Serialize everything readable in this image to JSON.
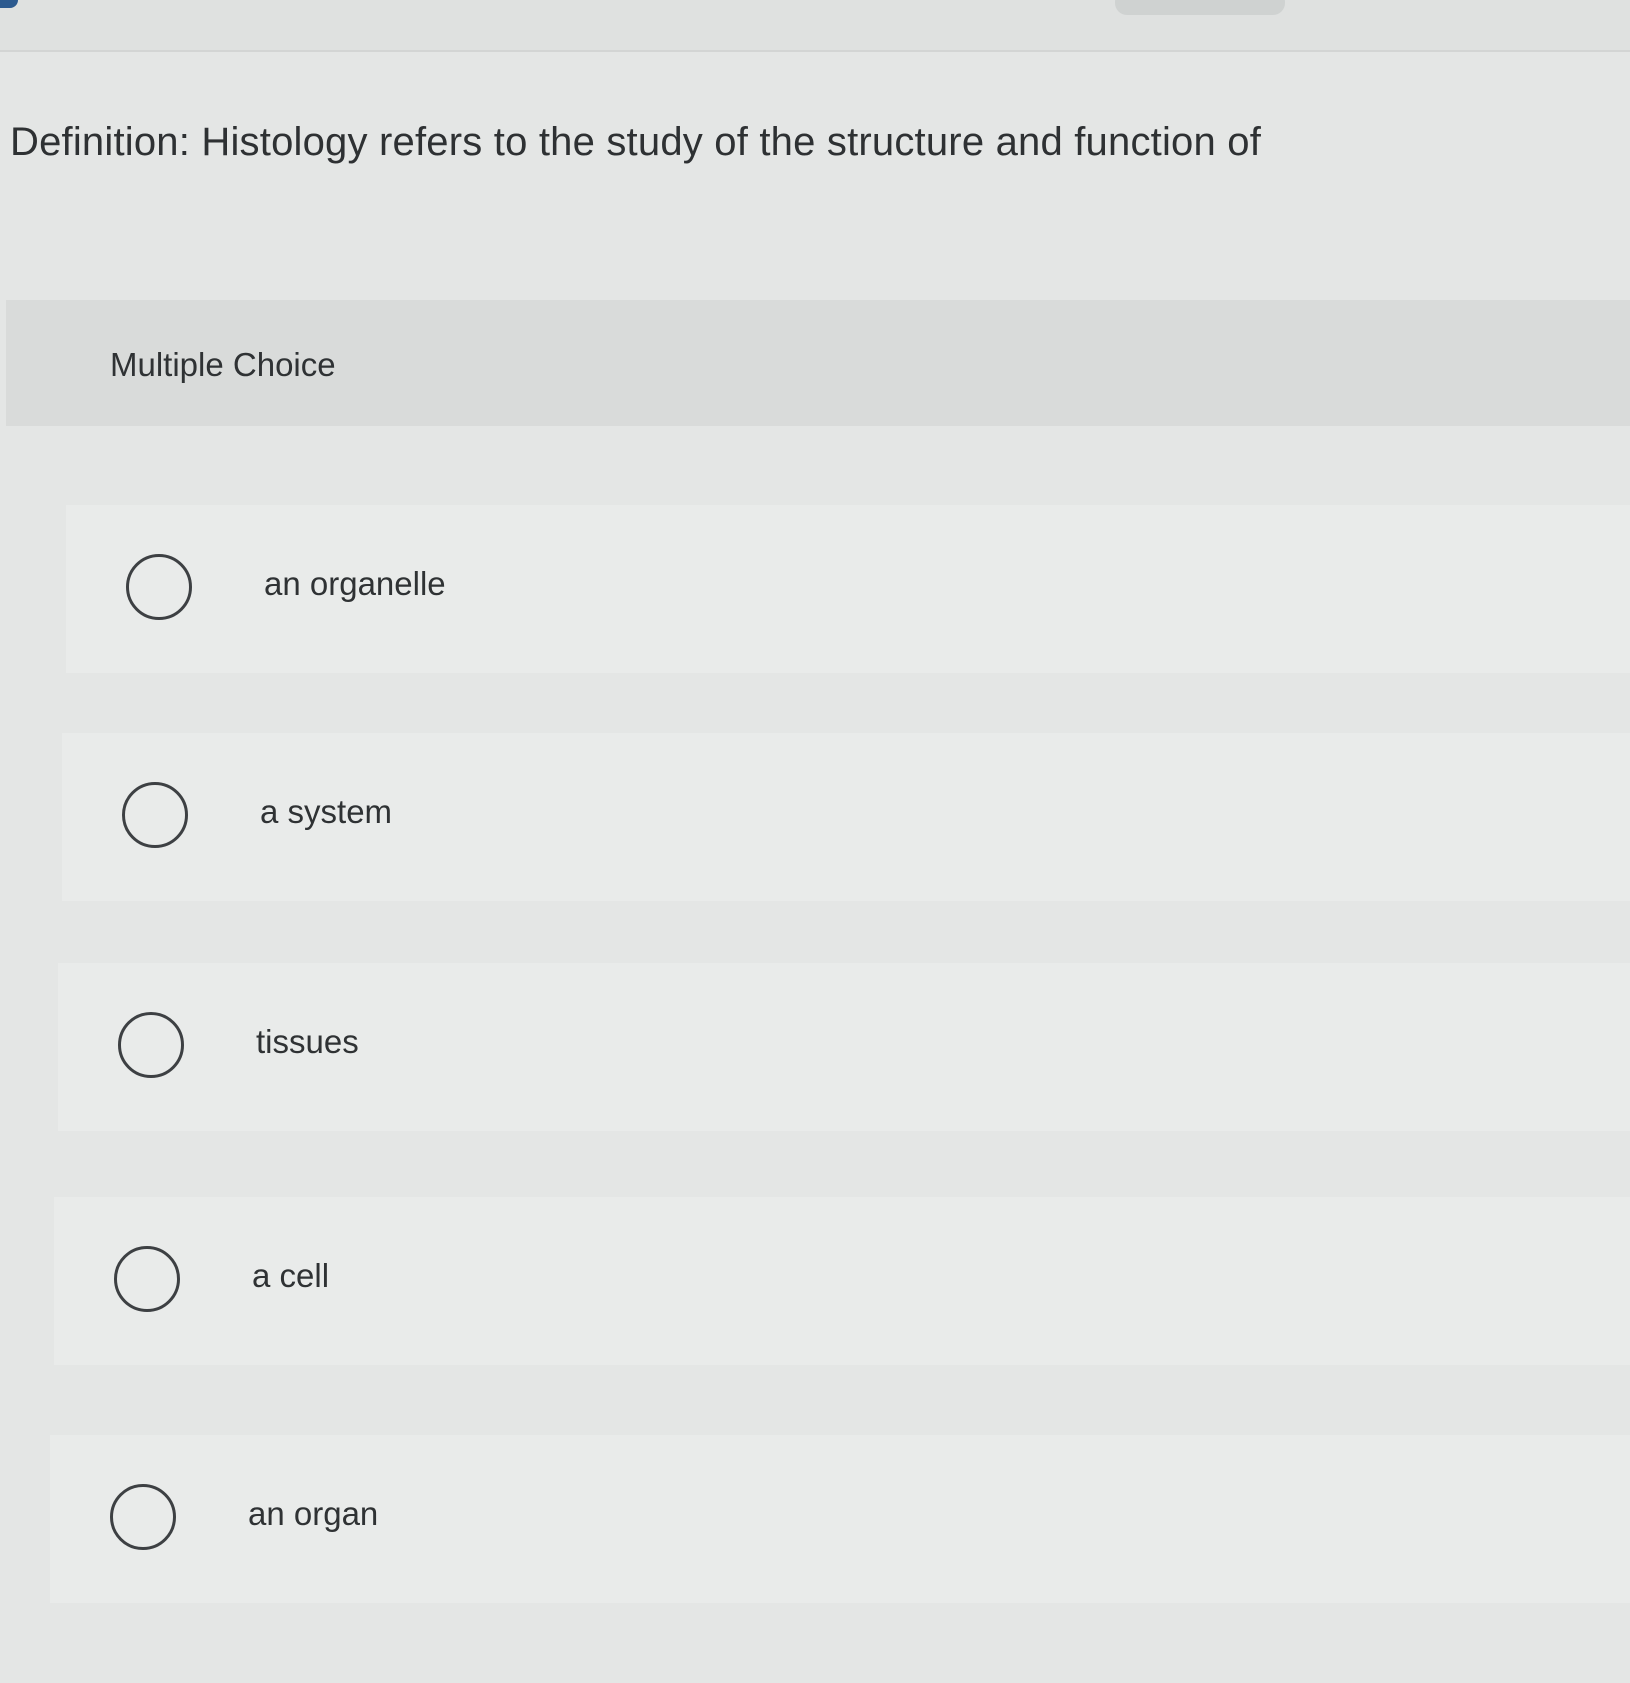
{
  "question": {
    "text": "Definition: Histology refers to the study of the structure and function of"
  },
  "section": {
    "label": "Multiple Choice"
  },
  "options": [
    {
      "label": "an organelle"
    },
    {
      "label": "a system"
    },
    {
      "label": "tissues"
    },
    {
      "label": "a cell"
    },
    {
      "label": "an organ"
    }
  ]
}
